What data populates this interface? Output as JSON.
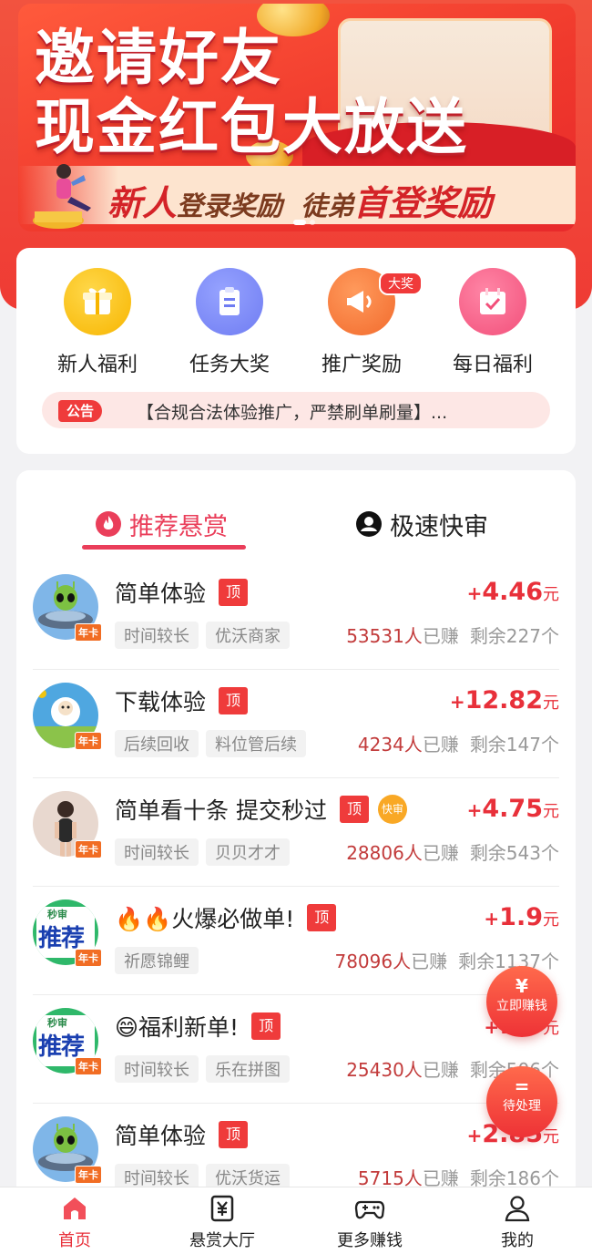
{
  "banner": {
    "title_line1": "邀请好友",
    "title_line2": "现金红包大放送",
    "strip_part1_big": "新人",
    "strip_part1_small": "登录奖励",
    "strip_part2_small": "徒弟",
    "strip_part2_big": "首登奖励"
  },
  "quick_menu": [
    {
      "label": "新人福利",
      "icon": "gift-icon",
      "color": "#f7b500"
    },
    {
      "label": "任务大奖",
      "icon": "clipboard-icon",
      "color": "#6f7cf2"
    },
    {
      "label": "推广奖励",
      "icon": "megaphone-icon",
      "color": "#f26b2d",
      "badge": "大奖"
    },
    {
      "label": "每日福利",
      "icon": "calendar-check-icon",
      "color": "#f24f7a"
    }
  ],
  "notice": {
    "tag": "公告",
    "text": "【合规合法体验推广，严禁刷单刷量】..."
  },
  "tabs": {
    "recommended": "推荐悬赏",
    "fast_review": "极速快审"
  },
  "tasks": [
    {
      "title": "简单体验",
      "top": "顶",
      "fast": "",
      "tags": [
        "时间较长",
        "优沃商家"
      ],
      "plus": "+",
      "amount": "4.46",
      "unit": "元",
      "earned": "53531人",
      "earned_label": "已赚",
      "remaining": "剩余227个",
      "avatar": "alien-ufo"
    },
    {
      "title": "下载体验",
      "top": "顶",
      "fast": "",
      "tags": [
        "后续回收",
        "料位管后续"
      ],
      "plus": "+",
      "amount": "12.82",
      "unit": "元",
      "earned": "4234人",
      "earned_label": "已赚",
      "remaining": "剩余147个",
      "avatar": "sheep"
    },
    {
      "title": "简单看十条 提交秒过",
      "top": "顶",
      "fast": "快审",
      "tags": [
        "时间较长",
        "贝贝才才"
      ],
      "plus": "+",
      "amount": "4.75",
      "unit": "元",
      "earned": "28806人",
      "earned_label": "已赚",
      "remaining": "剩余543个",
      "avatar": "person"
    },
    {
      "title": "🔥🔥火爆必做单!",
      "top": "顶",
      "fast": "",
      "tags": [
        "祈愿锦鲤"
      ],
      "plus": "+",
      "amount": "1.9",
      "unit": "元",
      "earned": "78096人",
      "earned_label": "已赚",
      "remaining": "剩余1137个",
      "avatar": "recommend",
      "avatar_top": "秒审",
      "avatar_main": "推荐"
    },
    {
      "title": "😄福利新单!",
      "top": "顶",
      "fast": "",
      "tags": [
        "时间较长",
        "乐在拼图"
      ],
      "plus": "+",
      "amount": "1.9",
      "unit": "元",
      "earned": "25430人",
      "earned_label": "已赚",
      "remaining": "剩余506个",
      "avatar": "recommend",
      "avatar_top": "秒审",
      "avatar_main": "推荐"
    },
    {
      "title": "简单体验",
      "top": "顶",
      "fast": "",
      "tags": [
        "时间较长",
        "优沃货运"
      ],
      "plus": "+",
      "amount": "2.85",
      "unit": "元",
      "earned": "5715人",
      "earned_label": "已赚",
      "remaining": "剩余186个",
      "avatar": "alien-ufo"
    }
  ],
  "avatar_badge": "年卡",
  "floating": {
    "earn_icon": "¥",
    "earn_label": "立即赚钱",
    "pending_icon": "=",
    "pending_label": "待处理"
  },
  "bottom_nav": [
    {
      "label": "首页",
      "icon": "home-icon",
      "active": true
    },
    {
      "label": "悬赏大厅",
      "icon": "yen-doc-icon",
      "active": false
    },
    {
      "label": "更多赚钱",
      "icon": "gamepad-icon",
      "active": false
    },
    {
      "label": "我的",
      "icon": "user-icon",
      "active": false
    }
  ],
  "colors": {
    "brand_red": "#ef3b34",
    "accent_pink": "#ea3e5a",
    "reward_red": "#e8303a"
  }
}
